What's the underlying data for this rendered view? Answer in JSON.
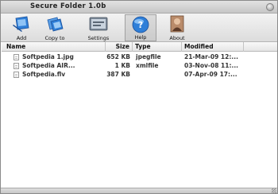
{
  "window": {
    "title": "Secure Folder 1.0b"
  },
  "toolbar": {
    "add": {
      "label": "Add",
      "icon": "add-file-icon"
    },
    "copy": {
      "label": "Copy to",
      "icon": "copy-files-icon"
    },
    "settings": {
      "label": "Settings",
      "icon": "settings-icon"
    },
    "help": {
      "label": "Help",
      "icon": "help-icon"
    },
    "about": {
      "label": "About",
      "icon": "about-icon"
    }
  },
  "table": {
    "columns": [
      "Name",
      "Size",
      "Type",
      "Modified"
    ],
    "rows": [
      {
        "name": "Softpedia 1.jpg",
        "size": "652 KB",
        "type": "jpegfile",
        "modified": "21-Mar-09 12:..."
      },
      {
        "name": "Softpedia AIR...",
        "size": "1 KB",
        "type": "xmlfile",
        "modified": "03-Nov-08 11:..."
      },
      {
        "name": "Softpedia.flv",
        "size": "387 KB",
        "type": "",
        "modified": "07-Apr-09 17:..."
      }
    ]
  }
}
